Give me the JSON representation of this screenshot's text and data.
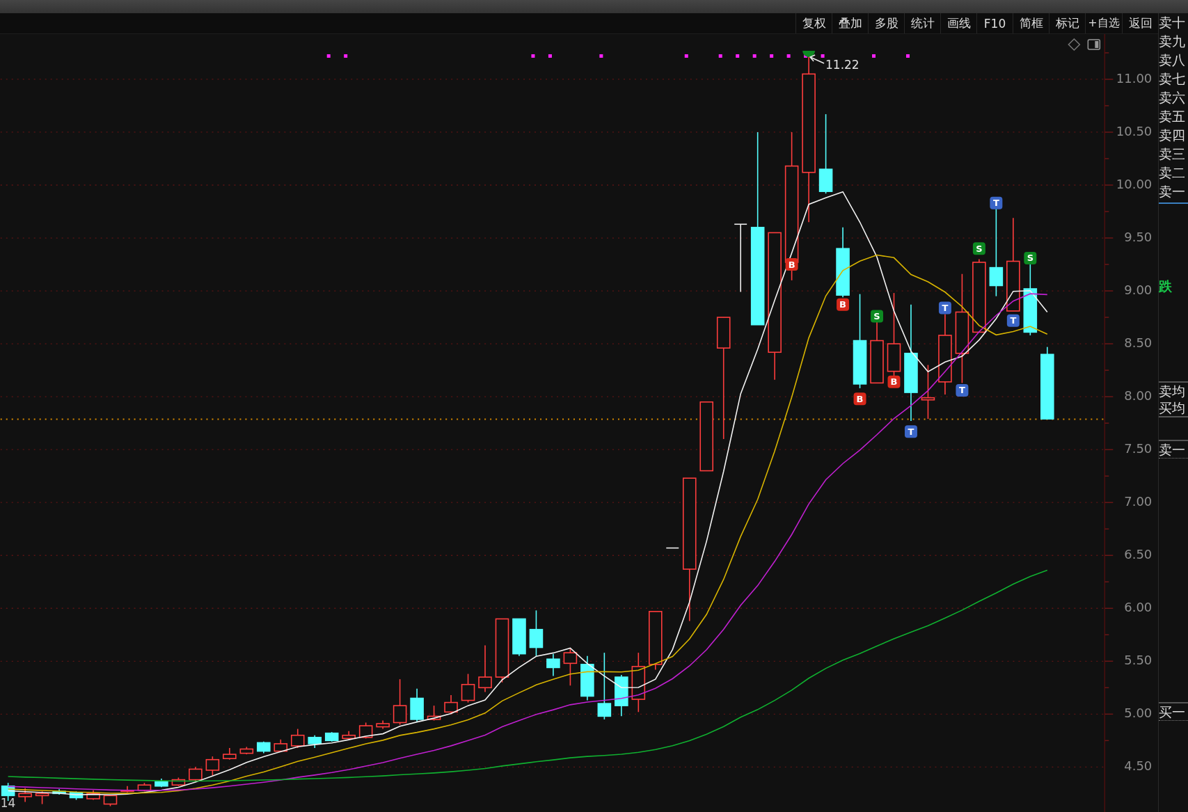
{
  "toolbar": [
    {
      "label": "复权"
    },
    {
      "label": "叠加"
    },
    {
      "label": "多股"
    },
    {
      "label": "统计"
    },
    {
      "label": "画线"
    },
    {
      "label": "F10"
    },
    {
      "label": "简框"
    },
    {
      "label": "标记"
    },
    {
      "label": "+自选"
    },
    {
      "label": "返回"
    }
  ],
  "chart": {
    "price_axis": [
      "11.00",
      "10.50",
      "10.00",
      "9.50",
      "9.00",
      "8.50",
      "8.00",
      "7.50",
      "7.00",
      "6.50",
      "6.00",
      "5.50",
      "5.00",
      "4.50"
    ],
    "high_annotation": "11.22",
    "date_label": "14",
    "signals": [
      {
        "label": "B",
        "kind": "buy"
      },
      {
        "label": "B",
        "kind": "buy"
      },
      {
        "label": "B",
        "kind": "buy"
      },
      {
        "label": "S",
        "kind": "sell"
      },
      {
        "label": "B",
        "kind": "buy"
      },
      {
        "label": "T",
        "kind": "t"
      },
      {
        "label": "T",
        "kind": "t"
      },
      {
        "label": "T",
        "kind": "t"
      },
      {
        "label": "S",
        "kind": "sell"
      },
      {
        "label": "T",
        "kind": "t"
      },
      {
        "label": "T",
        "kind": "t"
      },
      {
        "label": "S",
        "kind": "sell"
      }
    ]
  },
  "order_book": {
    "sell_levels": [
      "卖十",
      "卖九",
      "卖八",
      "卖七",
      "卖六",
      "卖五",
      "卖四",
      "卖三",
      "卖二",
      "卖一"
    ],
    "limit_label": "跌",
    "averages": [
      "卖均",
      "买均"
    ],
    "best_ask": "卖一",
    "best_bid": "买一"
  }
}
